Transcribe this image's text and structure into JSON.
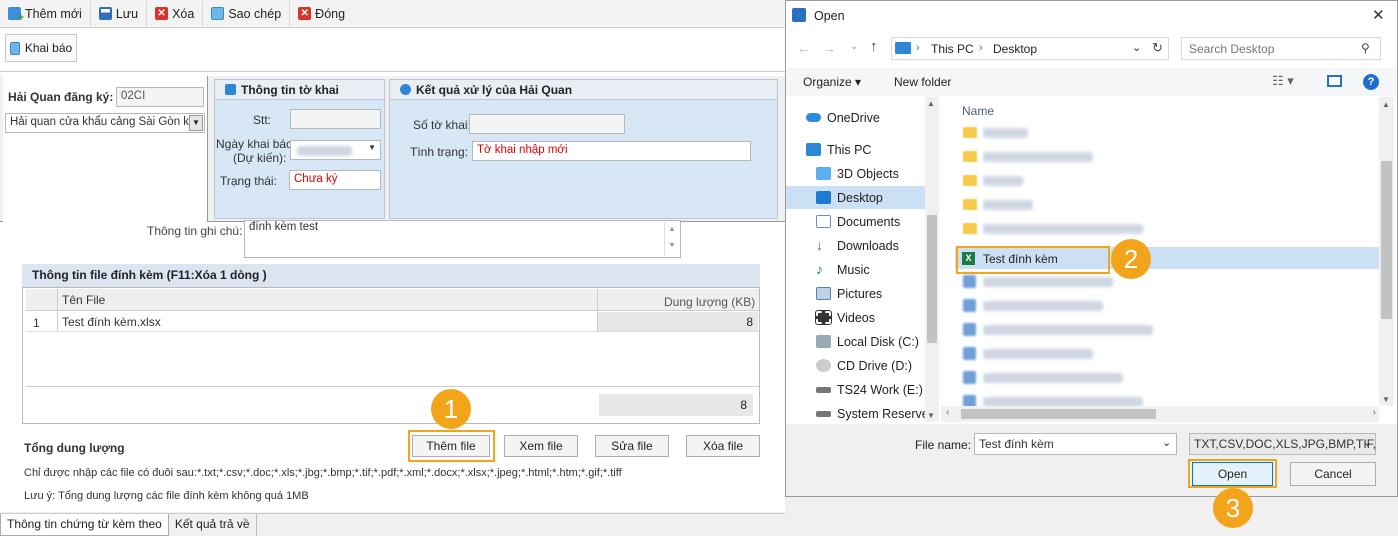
{
  "toolbar": {
    "items": [
      {
        "label": "Thêm mới",
        "icon": "add-icon"
      },
      {
        "label": "Lưu",
        "icon": "save-icon"
      },
      {
        "label": "Xóa",
        "icon": "delete-icon"
      },
      {
        "label": "Sao chép",
        "icon": "copy-icon"
      },
      {
        "label": "Đóng",
        "icon": "close-icon"
      }
    ],
    "khai_bao": "Khai báo"
  },
  "hai_quan": {
    "label": "Hải Quan đăng ký:",
    "code": "02CI",
    "name": "Hải quan cửa khẩu cảng Sài Gòn k..."
  },
  "thong_tin_to_khai": {
    "title": "Thông tin tờ khai",
    "stt_label": "Stt:",
    "stt_value": "",
    "ngay_label_1": "Ngày khai báo",
    "ngay_label_2": "(Dự kiến):",
    "trang_thai_label": "Trạng thái:",
    "trang_thai_value": "Chưa ký"
  },
  "ket_qua": {
    "title": "Kết quả xử lý của Hải Quan",
    "so_to_khai_label": "Số tờ khai:",
    "so_to_khai_value": "",
    "tinh_trang_label": "Tình trạng:",
    "tinh_trang_value": "Tờ khai nhập mới"
  },
  "ghi_chu": {
    "label": "Thông tin ghi chú:",
    "value": "đính kèm test"
  },
  "attach": {
    "title": "Thông tin file đính kèm (F11:Xóa 1 dòng )",
    "col_name": "Tên File",
    "col_size": "Dung lượng (KB)",
    "rows": [
      {
        "no": "1",
        "name": "Test đính kèm.xlsx",
        "size": "8"
      }
    ],
    "total": "8",
    "total_label": "Tổng dung lượng",
    "buttons": {
      "add": "Thêm file",
      "view": "Xem file",
      "edit": "Sửa file",
      "delete": "Xóa file"
    },
    "note1": "Chỉ được nhập các file có đuôi sau:*.txt;*.csv;*.doc;*.xls;*.jbg;*.bmp;*.tif;*.pdf;*.xml;*.docx;*.xlsx;*.jpeg;*.html;*.htm;*.gif;*.tiff",
    "note2": "Lưu ý: Tổng dung lượng các file đính kèm không quá 1MB"
  },
  "bottom_tabs": [
    "Thông tin chứng từ kèm theo",
    "Kết quả trả về"
  ],
  "dialog": {
    "title": "Open",
    "close": "✕",
    "path": [
      "This PC",
      "Desktop"
    ],
    "search_placeholder": "Search Desktop",
    "organize": "Organize ▾",
    "new_folder": "New folder",
    "col_name": "Name",
    "nav": [
      {
        "label": "OneDrive",
        "icon": "cloud-icon"
      },
      {
        "label": "This PC",
        "icon": "pc-icon"
      },
      {
        "label": "3D Objects",
        "icon": "cube-icon"
      },
      {
        "label": "Desktop",
        "icon": "desktop-icon"
      },
      {
        "label": "Documents",
        "icon": "document-icon"
      },
      {
        "label": "Downloads",
        "icon": "download-icon"
      },
      {
        "label": "Music",
        "icon": "music-icon"
      },
      {
        "label": "Pictures",
        "icon": "picture-icon"
      },
      {
        "label": "Videos",
        "icon": "video-icon"
      },
      {
        "label": "Local Disk (C:)",
        "icon": "disk-icon"
      },
      {
        "label": "CD Drive (D:)",
        "icon": "cd-icon"
      },
      {
        "label": "TS24 Work (E:)",
        "icon": "drive-icon"
      },
      {
        "label": "System Reserved",
        "icon": "drive-icon"
      }
    ],
    "selected_file": "Test đính kèm",
    "file_name_label": "File name:",
    "file_name_value": "Test đính kèm",
    "file_type": "TXT,CSV,DOC,XLS,JPG,BMP,TIF,",
    "open": "Open",
    "cancel": "Cancel"
  },
  "badges": [
    "1",
    "2",
    "3"
  ],
  "colors": {
    "accent": "#f2a51b",
    "selection": "#cce0f5",
    "panel": "#d7e7f6"
  }
}
